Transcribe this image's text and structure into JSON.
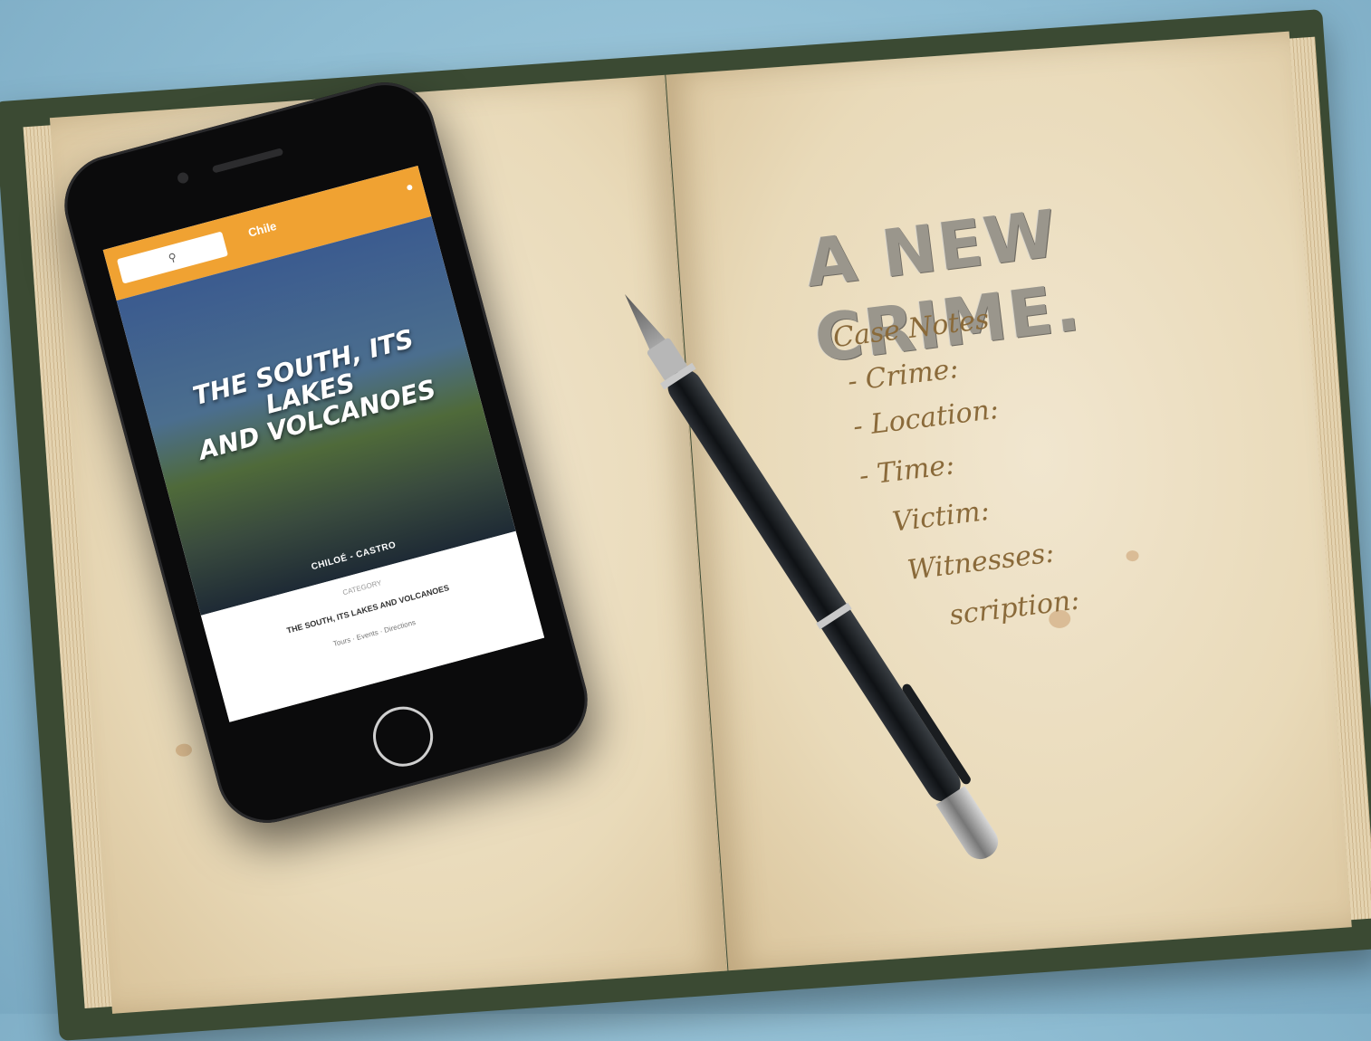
{
  "notebook": {
    "headline": "A NEW CRIME.",
    "section": "Case Notes",
    "fields": [
      "- Crime:",
      "- Location:",
      "- Time:",
      "Victim:",
      "Witnesses:",
      "scription:"
    ]
  },
  "phone": {
    "brand": "Chile",
    "search_icon": "search-icon",
    "hero_title_line1": "THE SOUTH, ITS LAKES",
    "hero_title_line2": "AND VOLCANOES",
    "place": "CHILOÉ - CASTRO",
    "category": "CATEGORY",
    "subtitle": "THE SOUTH, ITS LAKES AND VOLCANOES",
    "meta": "Tours  ·  Events  ·  Directions"
  }
}
